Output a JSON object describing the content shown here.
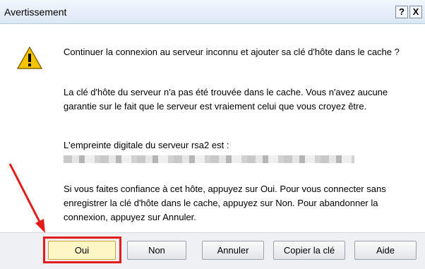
{
  "window": {
    "title": "Avertissement",
    "help_label": "?",
    "close_label": "X"
  },
  "message": {
    "question": "Continuer la connexion au serveur inconnu et ajouter sa clé d'hôte dans le cache ?",
    "warning": "La clé d'hôte du serveur n'a pas été trouvée dans le cache. Vous n'avez aucune garantie sur le fait que le serveur est vraiement celui que vous croyez être.",
    "fingerprint_label": "L'empreinte digitale du serveur rsa2 est :",
    "instructions": "Si vous faites confiance à cet hôte, appuyez sur Oui. Pour vous connecter sans enregistrer la clé d'hôte dans le cache, appuyez sur Non. Pour abandonner la connexion, appuyez sur Annuler."
  },
  "buttons": {
    "oui": "Oui",
    "non": "Non",
    "annuler": "Annuler",
    "copier": "Copier la clé",
    "aide": "Aide"
  },
  "icons": {
    "warning": "warning-triangle-icon"
  },
  "colors": {
    "annotation": "#e21b1b",
    "warning_fill": "#f5c400"
  }
}
